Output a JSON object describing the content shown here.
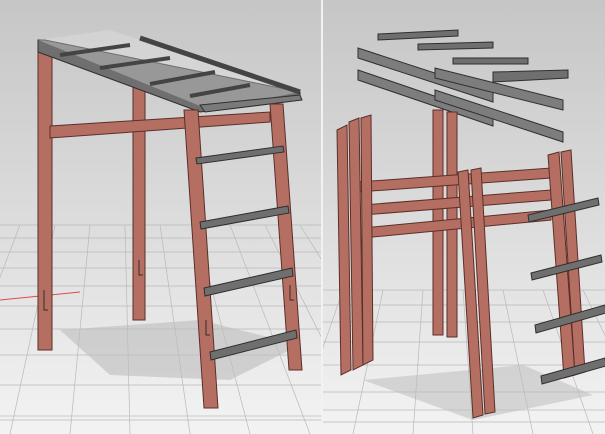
{
  "colors": {
    "wood": "#b56f62",
    "wood_light": "#c88576",
    "wood_dark": "#7a4139",
    "metal": "#6f6f6f",
    "metal_light": "#9a9a9a",
    "metal_dark": "#3c3c3c",
    "grid_line": "#b9b9b9",
    "axis_red": "#e24a4a",
    "bg_top": "#c9c9c9",
    "bg_bottom": "#f0f0f0"
  },
  "panels": [
    {
      "id": "assembled",
      "description_label": ""
    },
    {
      "id": "exploded",
      "description_label": ""
    }
  ]
}
